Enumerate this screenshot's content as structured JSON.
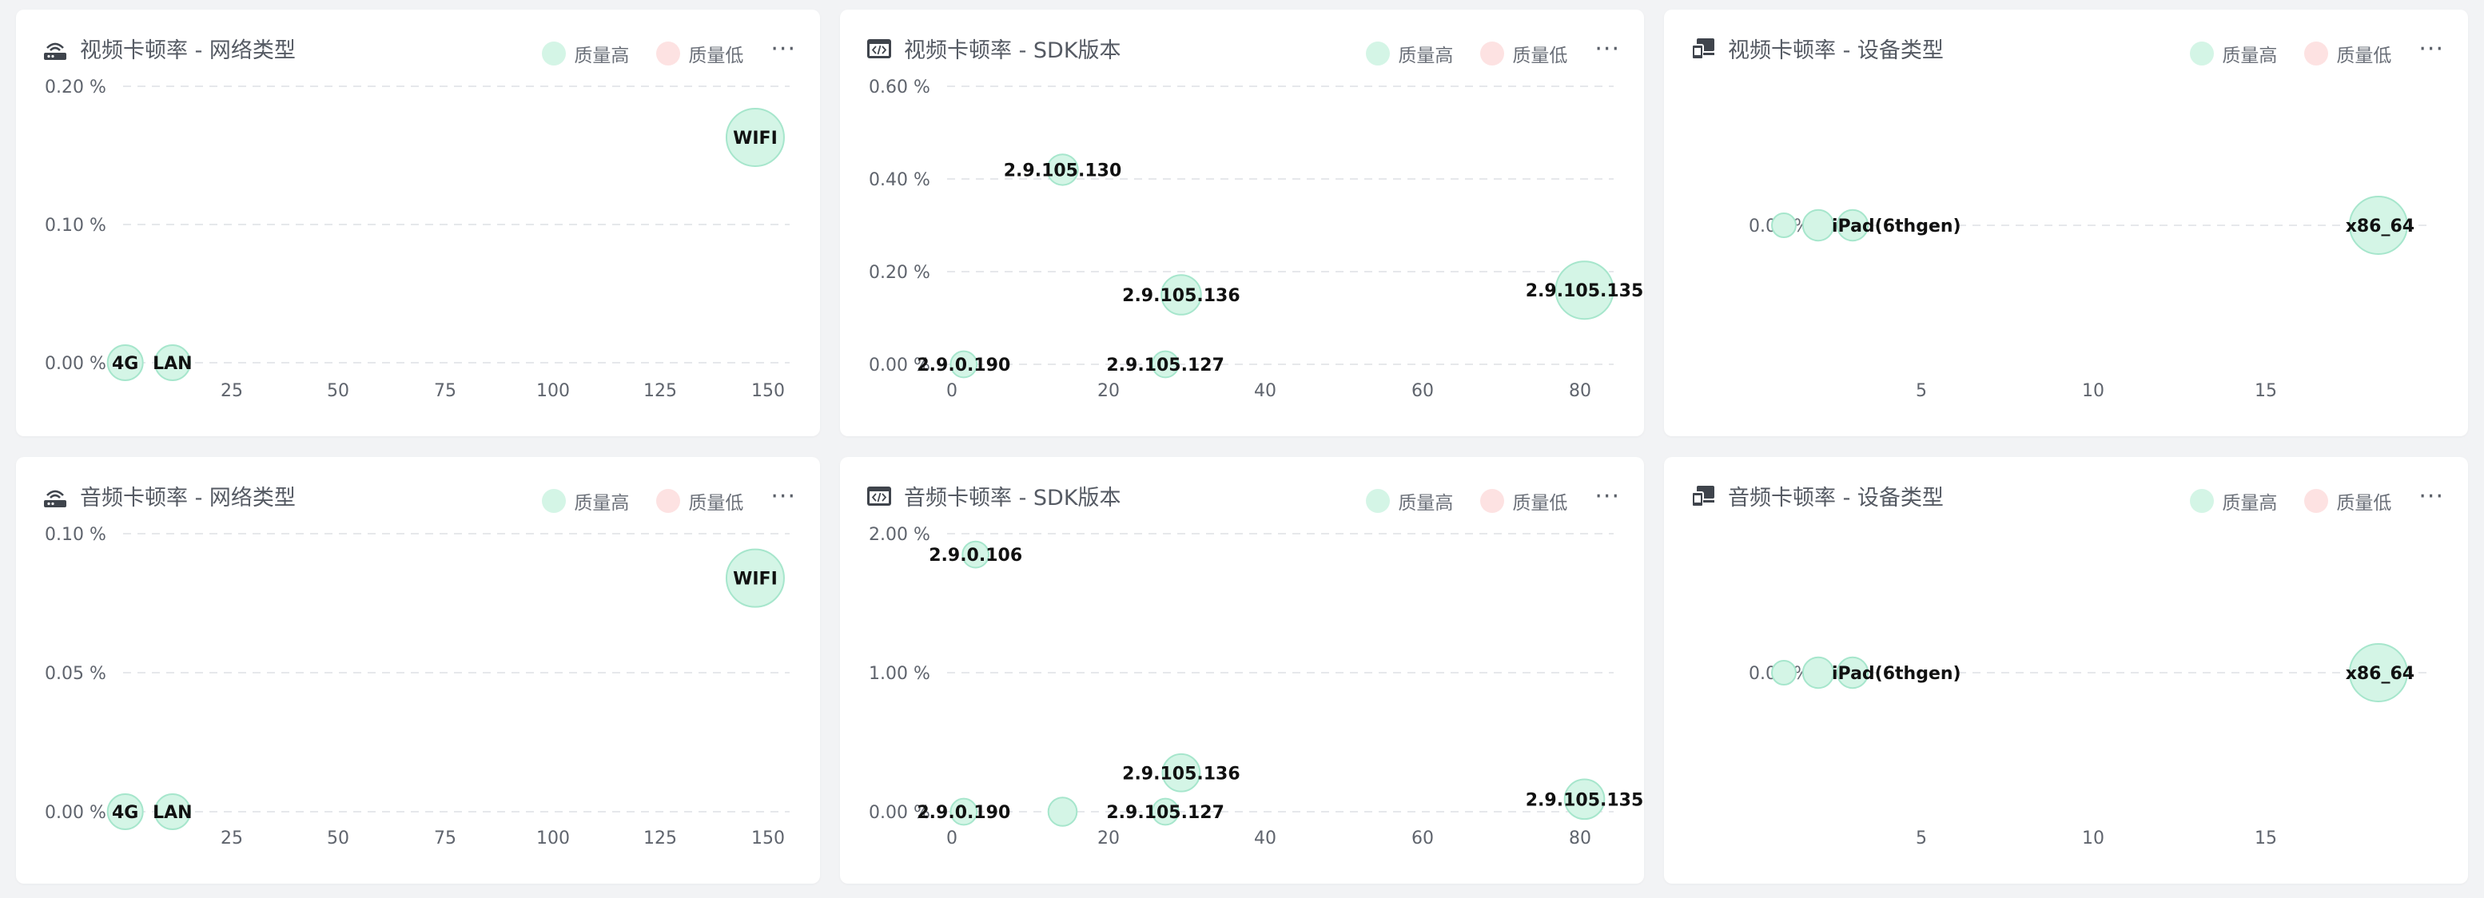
{
  "legend": {
    "high_label": "质量高",
    "low_label": "质量低",
    "more_label": "···"
  },
  "colors": {
    "high_fill": "#d4f5e6",
    "high_stroke": "#a6e6cc",
    "low_fill": "#fde2e2",
    "low_stroke": "#f5c2c2",
    "grid": "#e6e8eb",
    "axis_text": "#5f646d",
    "label_text": "#111111",
    "title_text": "#555a63",
    "icon": "#3f444c"
  },
  "charts": [
    {
      "title": "视频卡顿率 - 网络类型",
      "icon": "router-icon",
      "chart_data": {
        "type": "scatter",
        "xlim": [
          0,
          155
        ],
        "xticks": [
          "25",
          "50",
          "75",
          "100",
          "125",
          "150"
        ],
        "ylim": [
          0,
          0.2
        ],
        "yticks": [
          "0.20 %",
          "0.10 %",
          "0.00 %"
        ],
        "points": [
          {
            "label": "4G",
            "x": 0.5,
            "y": 0.0,
            "r": 0.5,
            "quality": "high"
          },
          {
            "label": "LAN",
            "x": 11.5,
            "y": 0.0,
            "r": 0.5,
            "quality": "high"
          },
          {
            "label": "WIFI",
            "x": 147.0,
            "y": 0.163,
            "r": 1.0,
            "quality": "high"
          }
        ]
      }
    },
    {
      "title": "视频卡顿率 - SDK版本",
      "icon": "code-icon",
      "chart_data": {
        "type": "scatter",
        "xlim": [
          0,
          85
        ],
        "xticks": [
          "0",
          "20",
          "40",
          "60",
          "80"
        ],
        "ylim": [
          0,
          0.6
        ],
        "yticks": [
          "0.60 %",
          "0.40 %",
          "0.20 %",
          "0.00 %"
        ],
        "points": [
          {
            "label": "2.9.0.190",
            "x": 1.5,
            "y": 0.0,
            "r": 0.3,
            "quality": "high"
          },
          {
            "label": "2.9.105.130",
            "x": 14.0,
            "y": 0.42,
            "r": 0.4,
            "quality": "high"
          },
          {
            "label": "2.9.105.136",
            "x": 29.0,
            "y": 0.15,
            "r": 0.6,
            "quality": "high"
          },
          {
            "label": "2.9.105.127",
            "x": 27.0,
            "y": 0.0,
            "r": 0.3,
            "quality": "high"
          },
          {
            "label": "2.9.105.135",
            "x": 80.0,
            "y": 0.16,
            "r": 1.0,
            "quality": "high"
          }
        ]
      }
    },
    {
      "title": "视频卡顿率 - 设备类型",
      "icon": "device-icon",
      "chart_data": {
        "type": "scatter",
        "xlim": [
          0,
          19
        ],
        "xticks": [
          "5",
          "10",
          "15"
        ],
        "ylim": [
          -0.1,
          0.1
        ],
        "yticks": [
          "0.00 %"
        ],
        "points": [
          {
            "label": "",
            "x": 1.0,
            "y": 0.0,
            "r": 0.25,
            "quality": "high"
          },
          {
            "label": "",
            "x": 2.0,
            "y": 0.0,
            "r": 0.4,
            "quality": "high"
          },
          {
            "label": "iPad(6thgen)",
            "x": 3.0,
            "y": 0.0,
            "r": 0.4,
            "quality": "high"
          },
          {
            "label": "x86_64",
            "x": 18.3,
            "y": 0.0,
            "r": 1.0,
            "quality": "high"
          }
        ]
      }
    },
    {
      "title": "音频卡顿率 - 网络类型",
      "icon": "router-icon",
      "chart_data": {
        "type": "scatter",
        "xlim": [
          0,
          155
        ],
        "xticks": [
          "25",
          "50",
          "75",
          "100",
          "125",
          "150"
        ],
        "ylim": [
          0,
          0.1
        ],
        "yticks": [
          "0.10 %",
          "0.05 %",
          "0.00 %"
        ],
        "points": [
          {
            "label": "4G",
            "x": 0.5,
            "y": 0.0,
            "r": 0.5,
            "quality": "high"
          },
          {
            "label": "LAN",
            "x": 11.5,
            "y": 0.0,
            "r": 0.5,
            "quality": "high"
          },
          {
            "label": "WIFI",
            "x": 147.0,
            "y": 0.084,
            "r": 1.0,
            "quality": "high"
          }
        ]
      }
    },
    {
      "title": "音频卡顿率 - SDK版本",
      "icon": "code-icon",
      "chart_data": {
        "type": "scatter",
        "xlim": [
          0,
          85
        ],
        "xticks": [
          "0",
          "20",
          "40",
          "60",
          "80"
        ],
        "ylim": [
          0,
          2.0
        ],
        "yticks": [
          "2.00 %",
          "1.00 %",
          "0.00 %"
        ],
        "points": [
          {
            "label": "2.9.0.106",
            "x": 3.0,
            "y": 1.85,
            "r": 0.3,
            "quality": "high"
          },
          {
            "label": "2.9.0.190",
            "x": 1.5,
            "y": 0.0,
            "r": 0.3,
            "quality": "high"
          },
          {
            "label": "",
            "x": 14.0,
            "y": 0.0,
            "r": 0.35,
            "quality": "high"
          },
          {
            "label": "2.9.105.136",
            "x": 29.0,
            "y": 0.28,
            "r": 0.55,
            "quality": "high"
          },
          {
            "label": "2.9.105.127",
            "x": 27.0,
            "y": 0.0,
            "r": 0.3,
            "quality": "high"
          },
          {
            "label": "2.9.105.135",
            "x": 80.0,
            "y": 0.09,
            "r": 0.6,
            "quality": "high"
          }
        ]
      }
    },
    {
      "title": "音频卡顿率 - 设备类型",
      "icon": "device-icon",
      "chart_data": {
        "type": "scatter",
        "xlim": [
          0,
          19
        ],
        "xticks": [
          "5",
          "10",
          "15"
        ],
        "ylim": [
          -0.1,
          0.1
        ],
        "yticks": [
          "0.00 %"
        ],
        "points": [
          {
            "label": "",
            "x": 1.0,
            "y": 0.0,
            "r": 0.25,
            "quality": "high"
          },
          {
            "label": "",
            "x": 2.0,
            "y": 0.0,
            "r": 0.4,
            "quality": "high"
          },
          {
            "label": "iPad(6thgen)",
            "x": 3.0,
            "y": 0.0,
            "r": 0.4,
            "quality": "high"
          },
          {
            "label": "x86_64",
            "x": 18.3,
            "y": 0.0,
            "r": 1.0,
            "quality": "high"
          }
        ]
      }
    }
  ]
}
